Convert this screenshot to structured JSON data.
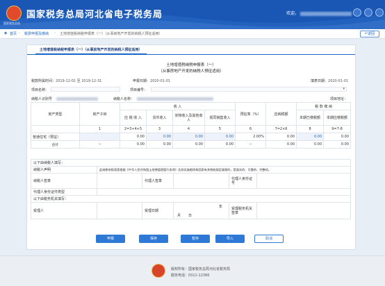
{
  "header": {
    "logo_caption": "国家税务总局",
    "title": "国家税务总局河北省电子税务局",
    "welcome": "欢迎，"
  },
  "breadcrumb": {
    "home": "首页",
    "level2": "税费申报及缴纳",
    "current": "土地增值税纳税申报表（一）（从事房地产开发的纳税人预征适用）",
    "back": "返回"
  },
  "tab": "土地增值税纳税申报表（一）（从事房地产开发的纳税人预征适用）",
  "form": {
    "title": "土地增值税纳税申报表（一）",
    "subtitle": "（从事房地产开发的纳税人预征适用）",
    "period_label": "税款所属时间：",
    "period_value": "2019-12-01 至 2019-12-31",
    "deadline_label": "申报日期：",
    "deadline_value": "2020-01-01",
    "filldate_label": "填表日期：",
    "filldate_value": "2020-01-01",
    "project_name_label": "项目名称：",
    "project_no_label": "项目编号：",
    "taxpayer_id_label": "纳税人识别号",
    "taxpayer_name_label": "纳税人名称：",
    "project_addr_label": "项目地址："
  },
  "table": {
    "h_house_type": "房产类型",
    "h_subtype": "房产子目",
    "h_income": "收 入",
    "h_rate": "预征率（%）",
    "h_tax_due": "应纳税额",
    "h_tax_paid": "税 款 缴 纳",
    "h_total_income": "应 税 收 入",
    "h_monetary": "货币收入",
    "h_nonmonetary": "实物收入及其他收入",
    "h_deemed": "视同销售收入",
    "h_this_paid": "本期已缴税额",
    "h_this_payable": "本期应缴税额",
    "idx_row": [
      "1",
      "2=3+4+5",
      "3",
      "4",
      "5",
      "6",
      "7=2×6",
      "8",
      "9=7-8"
    ],
    "rows": [
      {
        "type": "普通住宅（预征）",
        "sub": "",
        "c2": "0.00",
        "c3": "0.00",
        "c4": "0.00",
        "c5": "0.00",
        "c6": "2.00%",
        "c7": "0.00",
        "c8": "0.00",
        "c9": "0.00"
      },
      {
        "type": "合计",
        "sub": "--",
        "c2": "0.00",
        "c3": "0.00",
        "c4": "0.00",
        "c5": "0.00",
        "c6": "--",
        "c7": "0.00",
        "c8": "0.00",
        "c9": "0.00"
      }
    ]
  },
  "lower": {
    "taxpayer_fill": "以下由纳税人填写：",
    "declaration_label": "纳税人声明",
    "declaration_text": "此纳税申报表是根据《中华人民共和国土地增值税暂行条例》及其实施细则和国家有关税收规定填报的，是真实的、可靠的、完整的。",
    "seal_label": "纳税人签章",
    "agent_seal_label": "代理人签章",
    "agent_id_label": "代理人身份证号",
    "agent_id_type_label": "代理人身份证件类型",
    "tax_office_fill": "以下由税务机关填写：",
    "receiver_label": "受理人",
    "receive_date_label": "受理日期",
    "year": "年",
    "month": "月",
    "day": "日",
    "office_seal_label": "受理税务机关签章"
  },
  "buttons": {
    "declare": "申报",
    "save": "保存",
    "temp": "暂存",
    "import": "导入",
    "reset": "取消"
  },
  "footer": {
    "copyright": "版权所有：国家税务总局河北省税务局",
    "hotline": "服务电话：0311-12366"
  }
}
